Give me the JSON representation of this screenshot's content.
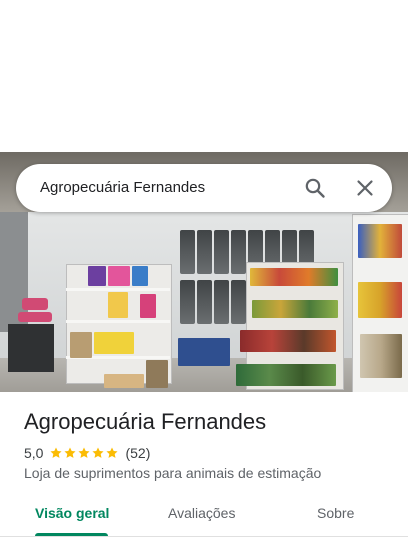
{
  "search": {
    "query": "Agropecuária Fernandes",
    "search_icon": "search-icon",
    "close_icon": "close-icon"
  },
  "photo": {
    "description_icon": "store-photo"
  },
  "place": {
    "name": "Agropecuária Fernandes",
    "rating": "5,0",
    "stars": 5,
    "review_count": "(52)",
    "category": "Loja de suprimentos para animais de estimação"
  },
  "tabs": [
    {
      "label": "Visão geral",
      "active": true
    },
    {
      "label": "Avaliações",
      "active": false
    },
    {
      "label": "Sobre",
      "active": false
    }
  ],
  "colors": {
    "accent": "#01875f",
    "star": "#fbbc04",
    "text_primary": "#202124",
    "text_secondary": "#5f6368"
  }
}
